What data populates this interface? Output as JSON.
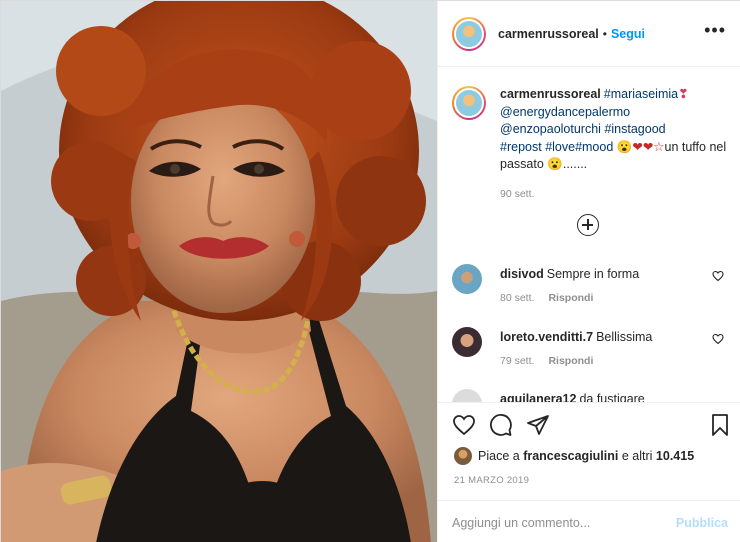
{
  "post": {
    "username": "carmenrussoreal",
    "follow_label": "Segui",
    "separator": "•",
    "more_label": "•••"
  },
  "caption": {
    "username": "carmenrussoreal",
    "hashtag1": "#mariaseimia",
    "emoji1": "❣",
    "mention1": "@energydancepalermo",
    "mention2": "@enzopaoloturchi",
    "hashtag2": "#instagood",
    "hashtag3": "#repost",
    "hashtag4": "#love#mood",
    "emoji2": "😮❤❤☆",
    "text": "un tuffo nel passato",
    "emoji3": "😮",
    "ellipsis": ".......",
    "time": "90 sett."
  },
  "comments": [
    {
      "username": "disivod",
      "text": "Sempre in forma",
      "time": "80 sett.",
      "reply": "Rispondi"
    },
    {
      "username": "loreto.venditti.7",
      "text": "Bellissima",
      "time": "79 sett.",
      "reply": "Rispondi"
    },
    {
      "username": "aquilanera12",
      "text": "da fustigare",
      "time": "",
      "reply": ""
    }
  ],
  "likes": {
    "prefix": "Piace a",
    "user": "francescagiulini",
    "connector": "e altri",
    "count": "10.415"
  },
  "date": "21 MARZO 2019",
  "add_comment": {
    "placeholder": "Aggiungi un commento...",
    "publish": "Pubblica"
  },
  "colors": {
    "link": "#0095f6",
    "publish_disabled": "#b2dffc",
    "muted": "#8e8e8e"
  }
}
